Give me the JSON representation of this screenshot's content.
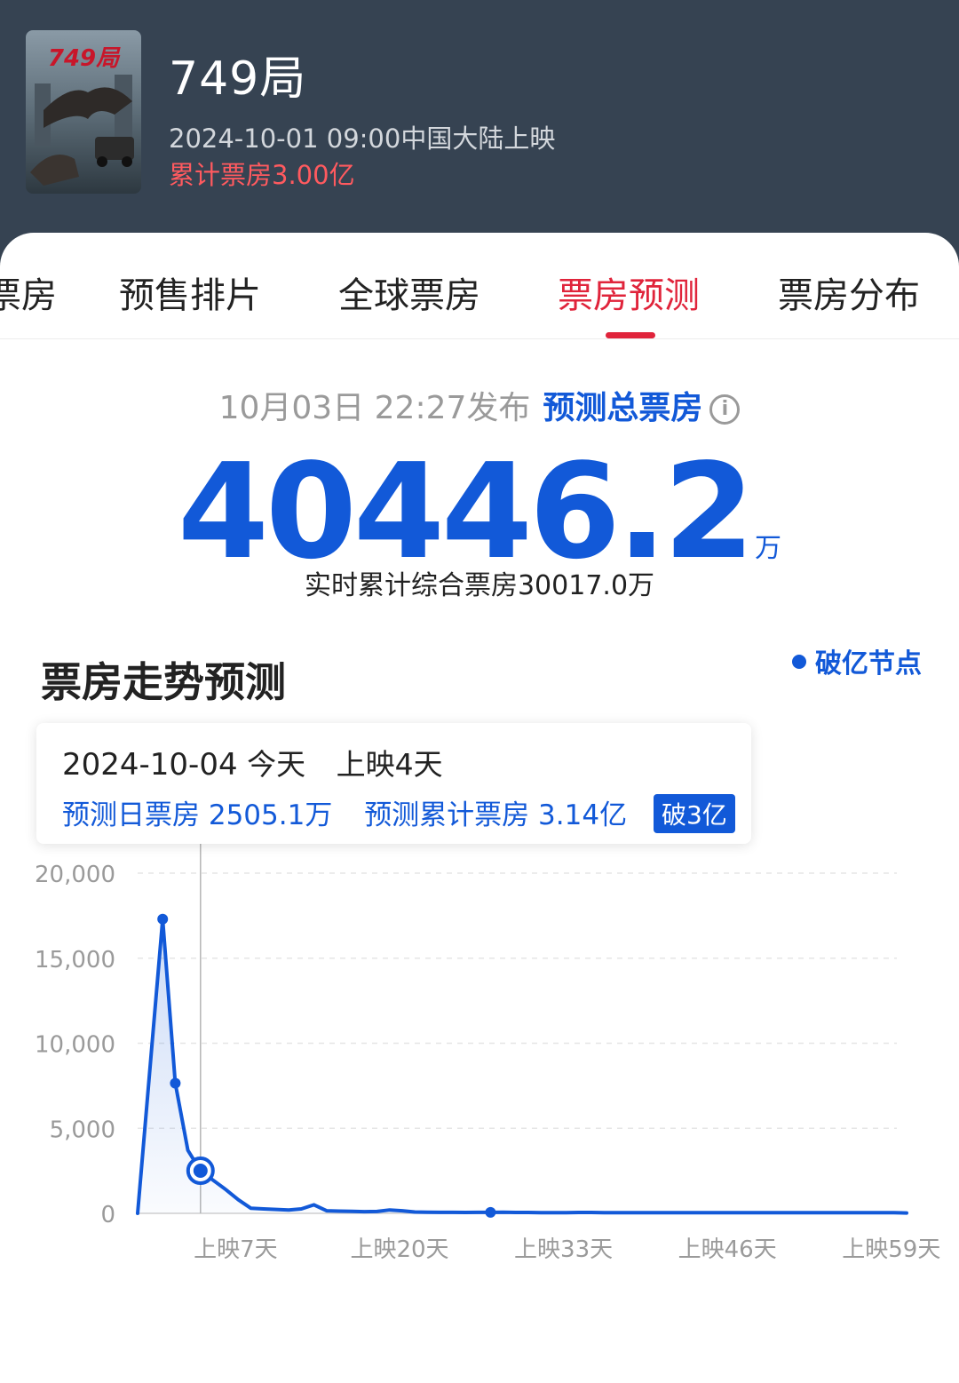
{
  "header": {
    "title": "749局",
    "release": "2024-10-01 09:00中国大陆上映",
    "total_gross": "累计票房3.00亿",
    "poster_text": "749局"
  },
  "tabs": [
    {
      "label": "票房",
      "active": false
    },
    {
      "label": "预售排片",
      "active": false
    },
    {
      "label": "全球票房",
      "active": false
    },
    {
      "label": "票房预测",
      "active": true
    },
    {
      "label": "票房分布",
      "active": false
    }
  ],
  "forecast": {
    "publish_time": "10月03日 22:27发布",
    "label": "预测总票房",
    "info_icon": "i",
    "value": "40446.2",
    "unit": "万",
    "realtime": "实时累计综合票房30017.0万"
  },
  "trend": {
    "title": "票房走势预测",
    "legend": "破亿节点"
  },
  "tooltip": {
    "date": "2024-10-04",
    "today": "今天",
    "day": "上映4天",
    "daily": "预测日票房 2505.1万",
    "cumulative": "预测累计票房 3.14亿",
    "badge": "破3亿"
  },
  "colors": {
    "accent_red": "#e0243b",
    "accent_blue": "#1259d8",
    "header_bg": "#364352"
  },
  "chart_data": {
    "type": "line",
    "x_tick_labels": [
      "上映7天",
      "上映20天",
      "上映33天",
      "上映46天",
      "上映59天"
    ],
    "x_tick_days": [
      7,
      20,
      33,
      46,
      59
    ],
    "y_tick_labels": [
      "20,000",
      "15,000",
      "10,000",
      "5,000",
      "0"
    ],
    "ylim": [
      0,
      20000
    ],
    "xlim": [
      -1,
      60
    ],
    "grid": true,
    "highlight_day": 4,
    "x": [
      0,
      1,
      2,
      3,
      4,
      5,
      6,
      7,
      8,
      9,
      10,
      11,
      12,
      13,
      14,
      15,
      16,
      17,
      18,
      19,
      20,
      21,
      22,
      23,
      24,
      25,
      26,
      27,
      28,
      29,
      30,
      31,
      32,
      33,
      34,
      35,
      36,
      37,
      38,
      39,
      40,
      41,
      42,
      43,
      44,
      45,
      46,
      47,
      48,
      49,
      50,
      51,
      52,
      53,
      54,
      55,
      56,
      57,
      58,
      59,
      60
    ],
    "y": [
      0,
      17300,
      7650,
      3700,
      2505,
      1950,
      1400,
      800,
      300,
      260,
      230,
      200,
      260,
      500,
      150,
      130,
      120,
      100,
      110,
      200,
      150,
      80,
      70,
      60,
      60,
      50,
      60,
      60,
      70,
      50,
      50,
      40,
      40,
      40,
      50,
      50,
      40,
      40,
      40,
      40,
      40,
      40,
      40,
      40,
      40,
      40,
      40,
      40,
      40,
      40,
      40,
      40,
      40,
      40,
      40,
      40,
      40,
      40,
      40,
      40,
      20
    ],
    "marker_days": [
      1,
      2,
      27
    ]
  }
}
